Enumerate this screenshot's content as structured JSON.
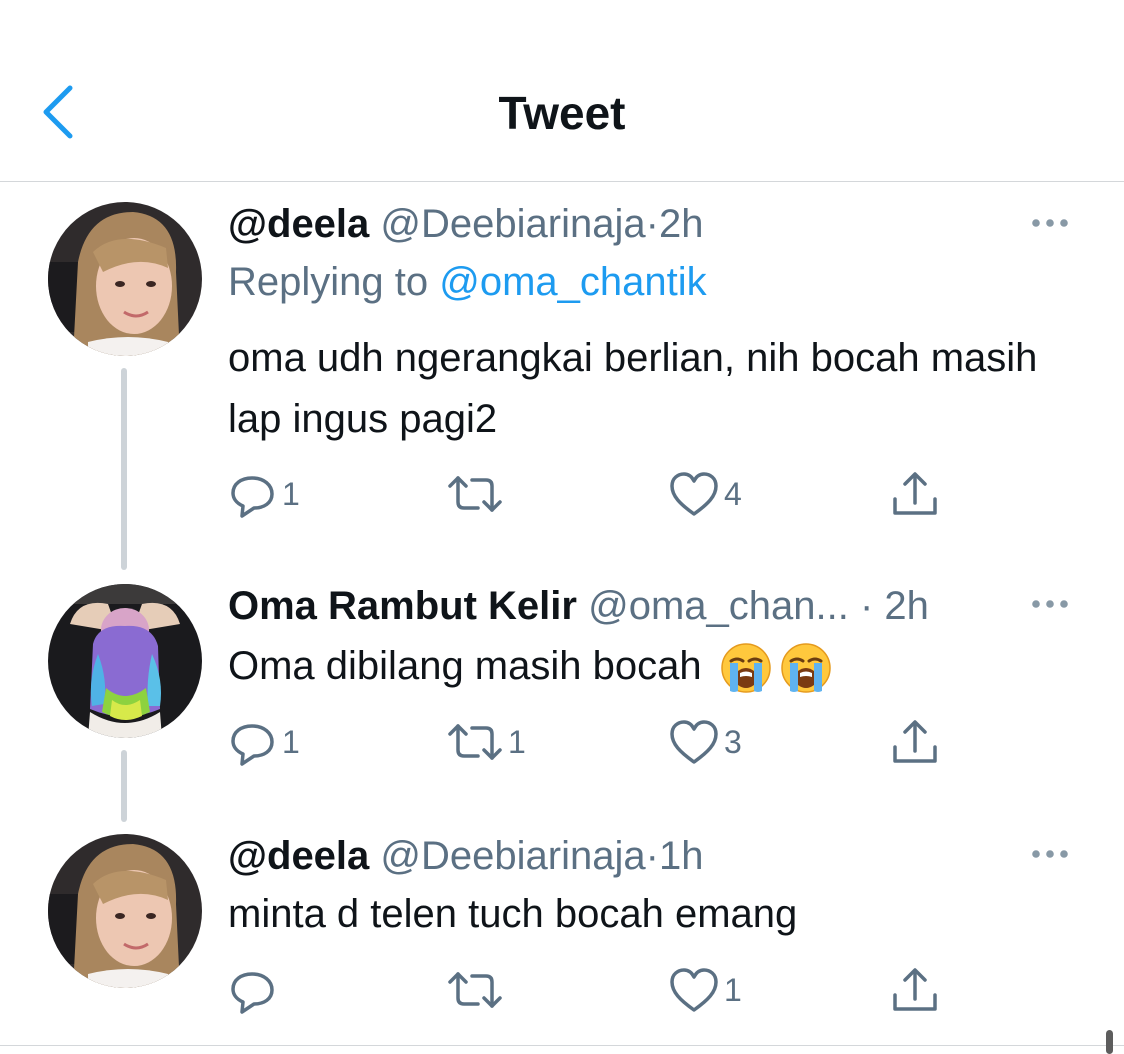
{
  "header": {
    "title": "Tweet"
  },
  "tweets": [
    {
      "name": "@deela",
      "handle": "@Deebiarinaja",
      "sep": "·",
      "time": "2h",
      "replying_prefix": "Replying to ",
      "replying_mention": "@oma_chantik",
      "text": "oma udh ngerangkai berlian, nih bocah masih lap ingus pagi2",
      "reply_count": "1",
      "retweet_count": "",
      "like_count": "4"
    },
    {
      "name": "Oma Rambut Kelir",
      "handle": "@oma_chan...",
      "sep": "·",
      "time": "2h",
      "text": "Oma dibilang masih bocah",
      "emojis": [
        "loudly-crying-face",
        "loudly-crying-face"
      ],
      "reply_count": "1",
      "retweet_count": "1",
      "like_count": "3"
    },
    {
      "name": "@deela",
      "handle": "@Deebiarinaja",
      "sep": "·",
      "time": "1h",
      "text": "minta d telen tuch bocah emang",
      "reply_count": "",
      "retweet_count": "",
      "like_count": "1"
    }
  ],
  "colors": {
    "accent": "#1d9bf0",
    "text": "#0f1419",
    "secondary": "#5b7083",
    "thread_line": "#cdd3d8"
  }
}
